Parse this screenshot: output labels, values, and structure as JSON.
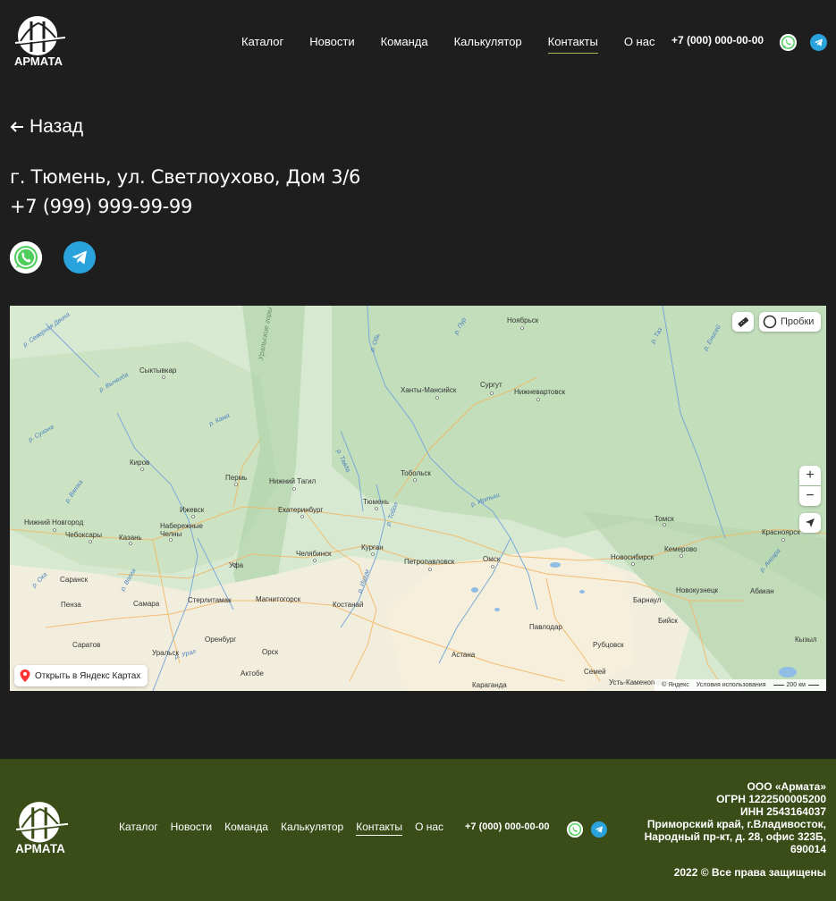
{
  "header": {
    "logo_text": "АРМАТА",
    "nav": [
      {
        "label": "Каталог",
        "active": false
      },
      {
        "label": "Новости",
        "active": false
      },
      {
        "label": "Команда",
        "active": false
      },
      {
        "label": "Калькулятор",
        "active": false
      },
      {
        "label": "Контакты",
        "active": true
      },
      {
        "label": "О нас",
        "active": false
      }
    ],
    "phone": "+7 (000) 000-00-00"
  },
  "main": {
    "back_label": "Назад",
    "address": "г. Тюмень, ул. Светлоухово, Дом 3/6",
    "phone": "+7 (999) 999-99-99"
  },
  "map": {
    "traffic_label": "Пробки",
    "open_label": "Открыть в Яндекс Картах",
    "copyright": "© Яндекс",
    "terms": "Условия использования",
    "scale": "200 км",
    "cities": [
      {
        "name": "Ноябрьск"
      },
      {
        "name": "Сыктывкар"
      },
      {
        "name": "Ханты-Мансийск"
      },
      {
        "name": "Сургут"
      },
      {
        "name": "Нижневартовск"
      },
      {
        "name": "Киров"
      },
      {
        "name": "Пермь"
      },
      {
        "name": "Нижний Тагил"
      },
      {
        "name": "Тобольск"
      },
      {
        "name": "Ижевск"
      },
      {
        "name": "Екатеринбург"
      },
      {
        "name": "Тюмень"
      },
      {
        "name": "Нижний Новгород"
      },
      {
        "name": "Чебоксары"
      },
      {
        "name": "Набережные Челны"
      },
      {
        "name": "Казань"
      },
      {
        "name": "Челябинск"
      },
      {
        "name": "Курган"
      },
      {
        "name": "Петропавловск"
      },
      {
        "name": "Омск"
      },
      {
        "name": "Томск"
      },
      {
        "name": "Новосибирск"
      },
      {
        "name": "Кемерово"
      },
      {
        "name": "Красноярск"
      },
      {
        "name": "Уфа"
      },
      {
        "name": "Саранск"
      },
      {
        "name": "Пенза"
      },
      {
        "name": "Самара"
      },
      {
        "name": "Стерлитамак"
      },
      {
        "name": "Магнитогорск"
      },
      {
        "name": "Костанай"
      },
      {
        "name": "Новокузнецк"
      },
      {
        "name": "Абакан"
      },
      {
        "name": "Барнаул"
      },
      {
        "name": "Бийск"
      },
      {
        "name": "Павлодар"
      },
      {
        "name": "Саратов"
      },
      {
        "name": "Оренбург"
      },
      {
        "name": "Орск"
      },
      {
        "name": "Рубцовск"
      },
      {
        "name": "Уральск"
      },
      {
        "name": "Актобе"
      },
      {
        "name": "Астана"
      },
      {
        "name": "Семей"
      },
      {
        "name": "Усть-Каменогорск"
      },
      {
        "name": "Караганда"
      },
      {
        "name": "Кызыл"
      }
    ],
    "regions": [
      {
        "name": "Уральские горы"
      }
    ],
    "rivers": [
      {
        "name": "р. Северная Двина"
      },
      {
        "name": "р. Вычегда"
      },
      {
        "name": "р. Сухона"
      },
      {
        "name": "р. Кама"
      },
      {
        "name": "р. Вятка"
      },
      {
        "name": "р. Обь"
      },
      {
        "name": "р. Пур"
      },
      {
        "name": "р. Таз"
      },
      {
        "name": "р. Енисей"
      },
      {
        "name": "р. Тавда"
      },
      {
        "name": "р. Иртыш"
      },
      {
        "name": "р. Тобол"
      },
      {
        "name": "р. Ишим"
      },
      {
        "name": "р. Волга"
      },
      {
        "name": "р. Урал"
      },
      {
        "name": "р. Ока"
      },
      {
        "name": "р. Ангара"
      }
    ]
  },
  "footer": {
    "logo_text": "АРМАТА",
    "nav": [
      {
        "label": "Каталог",
        "active": false
      },
      {
        "label": "Новости",
        "active": false
      },
      {
        "label": "Команда",
        "active": false
      },
      {
        "label": "Калькулятор",
        "active": false
      },
      {
        "label": "Контакты",
        "active": true
      },
      {
        "label": "О нас",
        "active": false
      }
    ],
    "phone": "+7 (000) 000-00-00",
    "company_lines": [
      "ООО «Армата»",
      "ОГРН 1222500005200",
      "ИНН 2543164037",
      "Приморский край, г.Владивосток,",
      "Народный пр-кт, д. 28, офис 323Б,",
      "690014"
    ],
    "rights": "2022 © Все права защищены"
  },
  "colors": {
    "background": "#1e1e1e",
    "footer": "#3a4c18",
    "accent": "#a6b84b",
    "telegram": "#2aa3dd",
    "whatsapp": "#4fce5d"
  }
}
